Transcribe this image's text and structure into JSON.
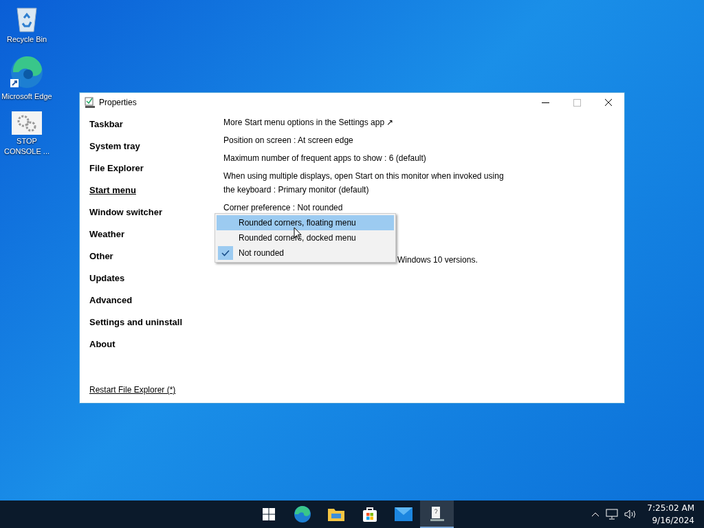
{
  "desktop_icons": [
    {
      "kind": "recycle",
      "label": "Recycle Bin"
    },
    {
      "kind": "edge",
      "label": "Microsoft Edge"
    },
    {
      "kind": "gears",
      "label": "STOP CONSOLE ..."
    }
  ],
  "window": {
    "title": "Properties",
    "sidebar": {
      "items": [
        {
          "label": "Taskbar",
          "selected": false
        },
        {
          "label": "System tray",
          "selected": false
        },
        {
          "label": "File Explorer",
          "selected": false
        },
        {
          "label": "Start menu",
          "selected": true
        },
        {
          "label": "Window switcher",
          "selected": false
        },
        {
          "label": "Weather",
          "selected": false
        },
        {
          "label": "Other",
          "selected": false
        },
        {
          "label": "Updates",
          "selected": false
        },
        {
          "label": "Advanced",
          "selected": false
        },
        {
          "label": "Settings and uninstall",
          "selected": false
        },
        {
          "label": "About",
          "selected": false
        }
      ],
      "footer_link": "Restart File Explorer (*)"
    },
    "settings": [
      {
        "kind": "link",
        "text": "More Start menu options in the Settings app",
        "arrow": "↗"
      },
      {
        "kind": "option",
        "text": "Position on screen : At screen edge"
      },
      {
        "kind": "option",
        "text": "Maximum number of frequent apps to show : 6 (default)"
      },
      {
        "kind": "option",
        "text": "When using multiple displays, open Start on this monitor when invoked using the keyboard : Primary monitor (default)"
      },
      {
        "kind": "option",
        "text": "Corner preference : Not rounded"
      }
    ],
    "note": "Windows 10 versions.",
    "dropdown": {
      "options": [
        {
          "label": "Rounded corners, floating menu",
          "highlighted": true,
          "checked": false
        },
        {
          "label": "Rounded corners, docked menu",
          "highlighted": false,
          "checked": false
        },
        {
          "label": "Not rounded",
          "highlighted": false,
          "checked": true
        }
      ]
    }
  },
  "taskbar": {
    "apps": [
      {
        "kind": "start",
        "active": false
      },
      {
        "kind": "edge",
        "active": false
      },
      {
        "kind": "folder",
        "active": false
      },
      {
        "kind": "store",
        "active": false
      },
      {
        "kind": "mail",
        "active": false
      },
      {
        "kind": "properties",
        "active": true
      }
    ],
    "time": "7:25:02 AM",
    "date": "9/16/2024"
  }
}
